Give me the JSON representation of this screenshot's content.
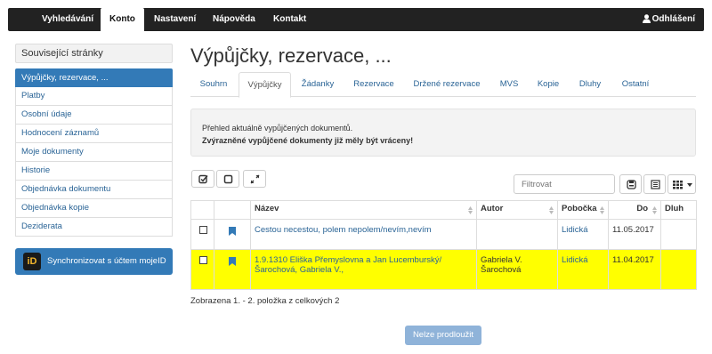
{
  "navbar": {
    "items": [
      "Vyhledávání",
      "Konto",
      "Nastavení",
      "Nápověda",
      "Kontakt"
    ],
    "active": "Konto",
    "logout_label": "Odhlášení"
  },
  "sidebar": {
    "heading": "Související stránky",
    "items": [
      "Výpůjčky, rezervace, ...",
      "Platby",
      "Osobní údaje",
      "Hodnocení záznamů",
      "Moje dokumenty",
      "Historie",
      "Objednávka dokumentu",
      "Objednávka kopie",
      "Deziderata"
    ],
    "mojeid_logo": "iD",
    "mojeid_label": "Synchronizovat s účtem mojeID"
  },
  "main": {
    "title": "Výpůjčky, rezervace, ...",
    "tabs": [
      "Souhrn",
      "Výpůjčky",
      "Žádanky",
      "Rezervace",
      "Držené rezervace",
      "MVS",
      "Kopie",
      "Dluhy",
      "Ostatní"
    ],
    "active_tab": "Výpůjčky",
    "info_line1": "Přehled aktuálně vypůjčených dokumentů.",
    "info_line2": "Zvýrazněné vypůjčené dokumenty již měly být vráceny!",
    "filter_placeholder": "Filtrovat",
    "table": {
      "headers": [
        "",
        "",
        "Název",
        "Autor",
        "Pobočka",
        "Do",
        "Dluh"
      ],
      "rows": [
        {
          "title": "Cestou necestou, polem nepolem/nevím,nevím",
          "author": "",
          "branch": "Lidická",
          "due": "11.05.2017",
          "debt": "",
          "overdue": false
        },
        {
          "title": "1.9.1310 Eliška Přemyslovna a Jan Lucemburský/Šarochová, Gabriela V.,",
          "author": "Gabriela V. Šarochová",
          "branch": "Lidická",
          "due": "11.04.2017",
          "debt": "",
          "overdue": true
        }
      ]
    },
    "count_text": "Zobrazena 1. - 2. položka z celkových 2",
    "extend_button": "Nelze prodloužit"
  },
  "colors": {
    "navbar": "#222222",
    "accent": "#337ab7",
    "overdue_row": "#ffff00",
    "link": "#2a6496"
  }
}
